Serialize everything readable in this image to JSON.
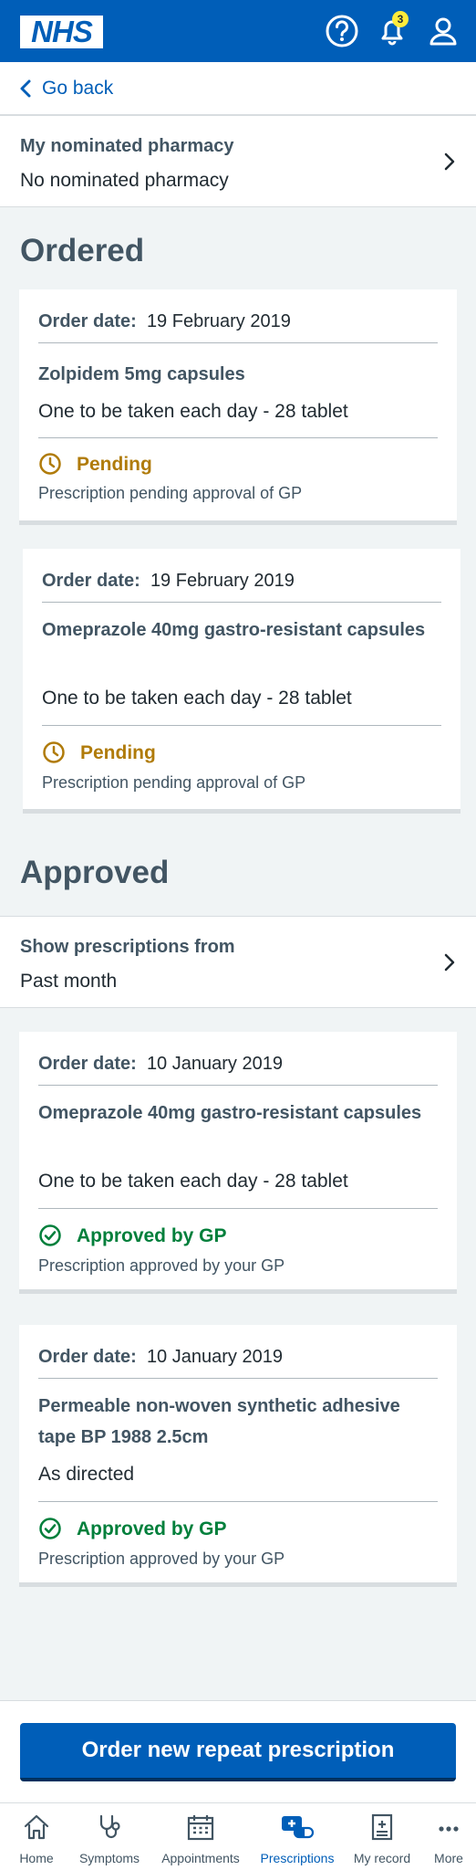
{
  "header": {
    "logo_text": "NHS",
    "notification_count": "3",
    "icons": [
      "help-icon",
      "bell-icon",
      "account-icon"
    ]
  },
  "back": {
    "label": "Go back"
  },
  "nominated_pharmacy": {
    "title": "My nominated pharmacy",
    "value": "No nominated pharmacy"
  },
  "sections": {
    "ordered_heading": "Ordered",
    "approved_heading": "Approved"
  },
  "ordered": [
    {
      "order_date_label": "Order date:",
      "order_date": "19 February 2019",
      "medicine": "Zolpidem 5mg capsules",
      "dosage": "One to be taken each day - 28 tablet",
      "status": "Pending",
      "status_desc": "Prescription pending approval of GP"
    },
    {
      "order_date_label": "Order date:",
      "order_date": "19 February 2019",
      "medicine": "Omeprazole 40mg gastro-resistant capsules",
      "dosage": "One to be taken each day - 28 tablet",
      "status": "Pending",
      "status_desc": "Prescription pending approval of GP"
    }
  ],
  "filter": {
    "title": "Show prescriptions from",
    "value": "Past month"
  },
  "approved": [
    {
      "order_date_label": "Order date:",
      "order_date": "10 January 2019",
      "medicine": "Omeprazole 40mg gastro-resistant capsules",
      "dosage": "One to be taken each day - 28 tablet",
      "status": "Approved by GP",
      "status_desc": "Prescription approved by your GP"
    },
    {
      "order_date_label": "Order date:",
      "order_date": "10 January 2019",
      "medicine": "Permeable non-woven synthetic adhesive tape BP 1988 2.5cm",
      "dosage": "As directed",
      "status": "Approved by GP",
      "status_desc": "Prescription approved by your GP"
    }
  ],
  "order_button": {
    "label": "Order new repeat prescription"
  },
  "tabs": [
    {
      "label": "Home",
      "icon": "home-icon"
    },
    {
      "label": "Symptoms",
      "icon": "stethoscope-icon"
    },
    {
      "label": "Appointments",
      "icon": "calendar-icon"
    },
    {
      "label": "Prescriptions",
      "icon": "prescriptions-icon",
      "active": true
    },
    {
      "label": "My record",
      "icon": "record-icon"
    },
    {
      "label": "More",
      "icon": "more-icon"
    }
  ],
  "colors": {
    "brand_blue": "#005eb8",
    "pending": "#b07b0a",
    "approved": "#007f3b",
    "background": "#f0f4f5"
  }
}
